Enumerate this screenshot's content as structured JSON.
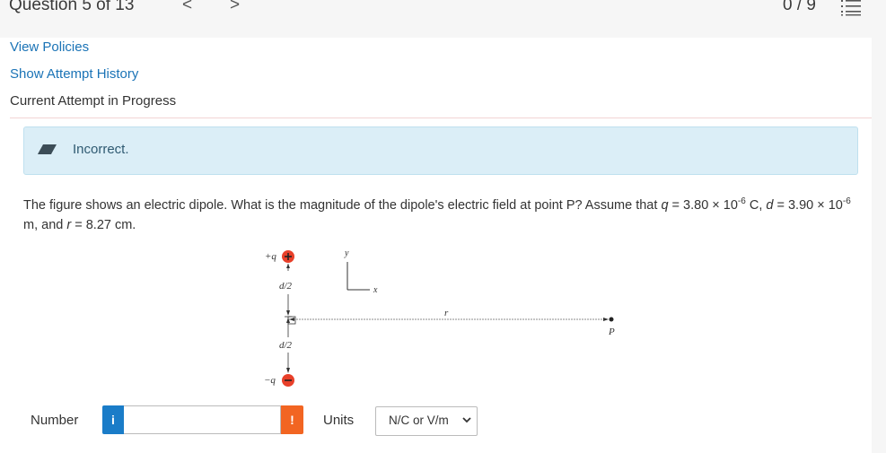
{
  "header": {
    "question_label": "Question 5 of 13",
    "prev_glyph": "<",
    "next_glyph": ">",
    "score": "0 / 9",
    "menu_icon": "list-icon"
  },
  "links": {
    "view_policies": "View Policies",
    "attempt_history": "Show Attempt History"
  },
  "status": {
    "current_attempt": "Current Attempt in Progress",
    "alert_text": "Incorrect.",
    "alert_icon": "eraser-icon"
  },
  "question": {
    "part1": "The figure shows an electric dipole. What is the magnitude of the dipole's electric field at point P? Assume that ",
    "q_var": "q",
    "q_eq": " = 3.80 × 10",
    "q_exp": "-6",
    "q_unit": " C, ",
    "d_var": "d",
    "d_eq": " = 3.90 × 10",
    "d_exp": "-6",
    "d_unit": " m, and ",
    "r_var": "r",
    "r_eq": " = 8.27 cm."
  },
  "figure": {
    "plus_charge": "+q",
    "minus_charge": "−q",
    "half_d_top": "d/2",
    "half_d_bottom": "d/2",
    "axis_y": "y",
    "axis_x": "x",
    "distance": "r",
    "point": "P",
    "plus_color": "#e8402a",
    "minus_color": "#e8402a"
  },
  "answer": {
    "number_label": "Number",
    "info_glyph": "i",
    "number_value": "",
    "warn_glyph": "!",
    "units_label": "Units",
    "units_selected": "N/C or V/m",
    "info_color": "#1a7cc8",
    "warn_color": "#f26522"
  }
}
